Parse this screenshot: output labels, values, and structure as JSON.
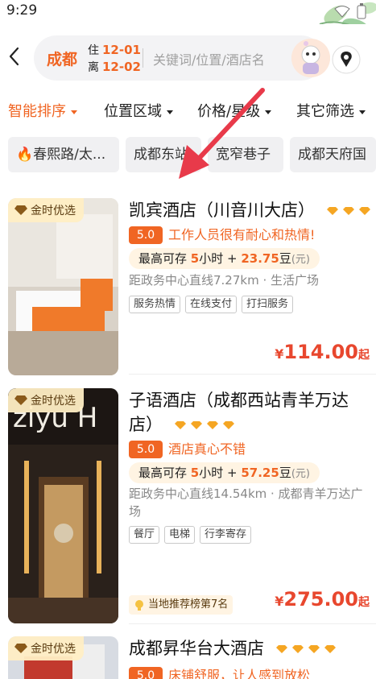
{
  "status_bar": {
    "time": "9:29"
  },
  "header": {
    "city": "成都",
    "checkin_label": "住",
    "checkin_date": "12-01",
    "checkout_label": "离",
    "checkout_date": "12-02",
    "search_placeholder": "关键词/位置/酒店名"
  },
  "filters": [
    {
      "label": "智能排序",
      "active": true
    },
    {
      "label": "位置区域",
      "active": false
    },
    {
      "label": "价格/星级",
      "active": false
    },
    {
      "label": "其它筛选",
      "active": false
    }
  ],
  "quick_tags": [
    "春熙路/太...",
    "成都东站",
    "宽窄巷子",
    "成都天府国"
  ],
  "hotels": [
    {
      "badge": "金时优选",
      "name": "凯宾酒店（川音川大店）",
      "diamonds": 3,
      "score": "5.0",
      "review": "工作人员很有耐心和热情!",
      "stay_prefix": "最高可存",
      "stay_hours": "5",
      "stay_unit": "小时 +",
      "stay_beans": "23.75",
      "stay_bean_unit": "豆",
      "stay_currency": "(元)",
      "distance": "距政务中心直线7.27km · 生活广场",
      "tags": [
        "服务热情",
        "在线支付",
        "打扫服务"
      ],
      "price_symbol": "¥",
      "price": "114.00",
      "price_suffix": "起"
    },
    {
      "badge": "金时优选",
      "name_line1": "子语酒店（成都西站青羊万达",
      "name_line2": "店）",
      "diamonds": 4,
      "score": "5.0",
      "review": "酒店真心不错",
      "stay_prefix": "最高可存",
      "stay_hours": "5",
      "stay_unit": "小时 +",
      "stay_beans": "57.25",
      "stay_bean_unit": "豆",
      "stay_currency": "(元)",
      "distance": "距政务中心直线14.54km · 成都青羊万达广场",
      "tags": [
        "餐厅",
        "电梯",
        "行李寄存"
      ],
      "rank": "当地推荐榜第7名",
      "price_symbol": "¥",
      "price": "275.00",
      "price_suffix": "起"
    },
    {
      "badge": "金时优选",
      "name": "成都昇华台大酒店",
      "diamonds": 4,
      "score": "5.0",
      "review": "床铺舒服，让人感到放松"
    }
  ],
  "colors": {
    "accent": "#f06523",
    "price": "#e8472e",
    "gold": "#f5a623"
  }
}
